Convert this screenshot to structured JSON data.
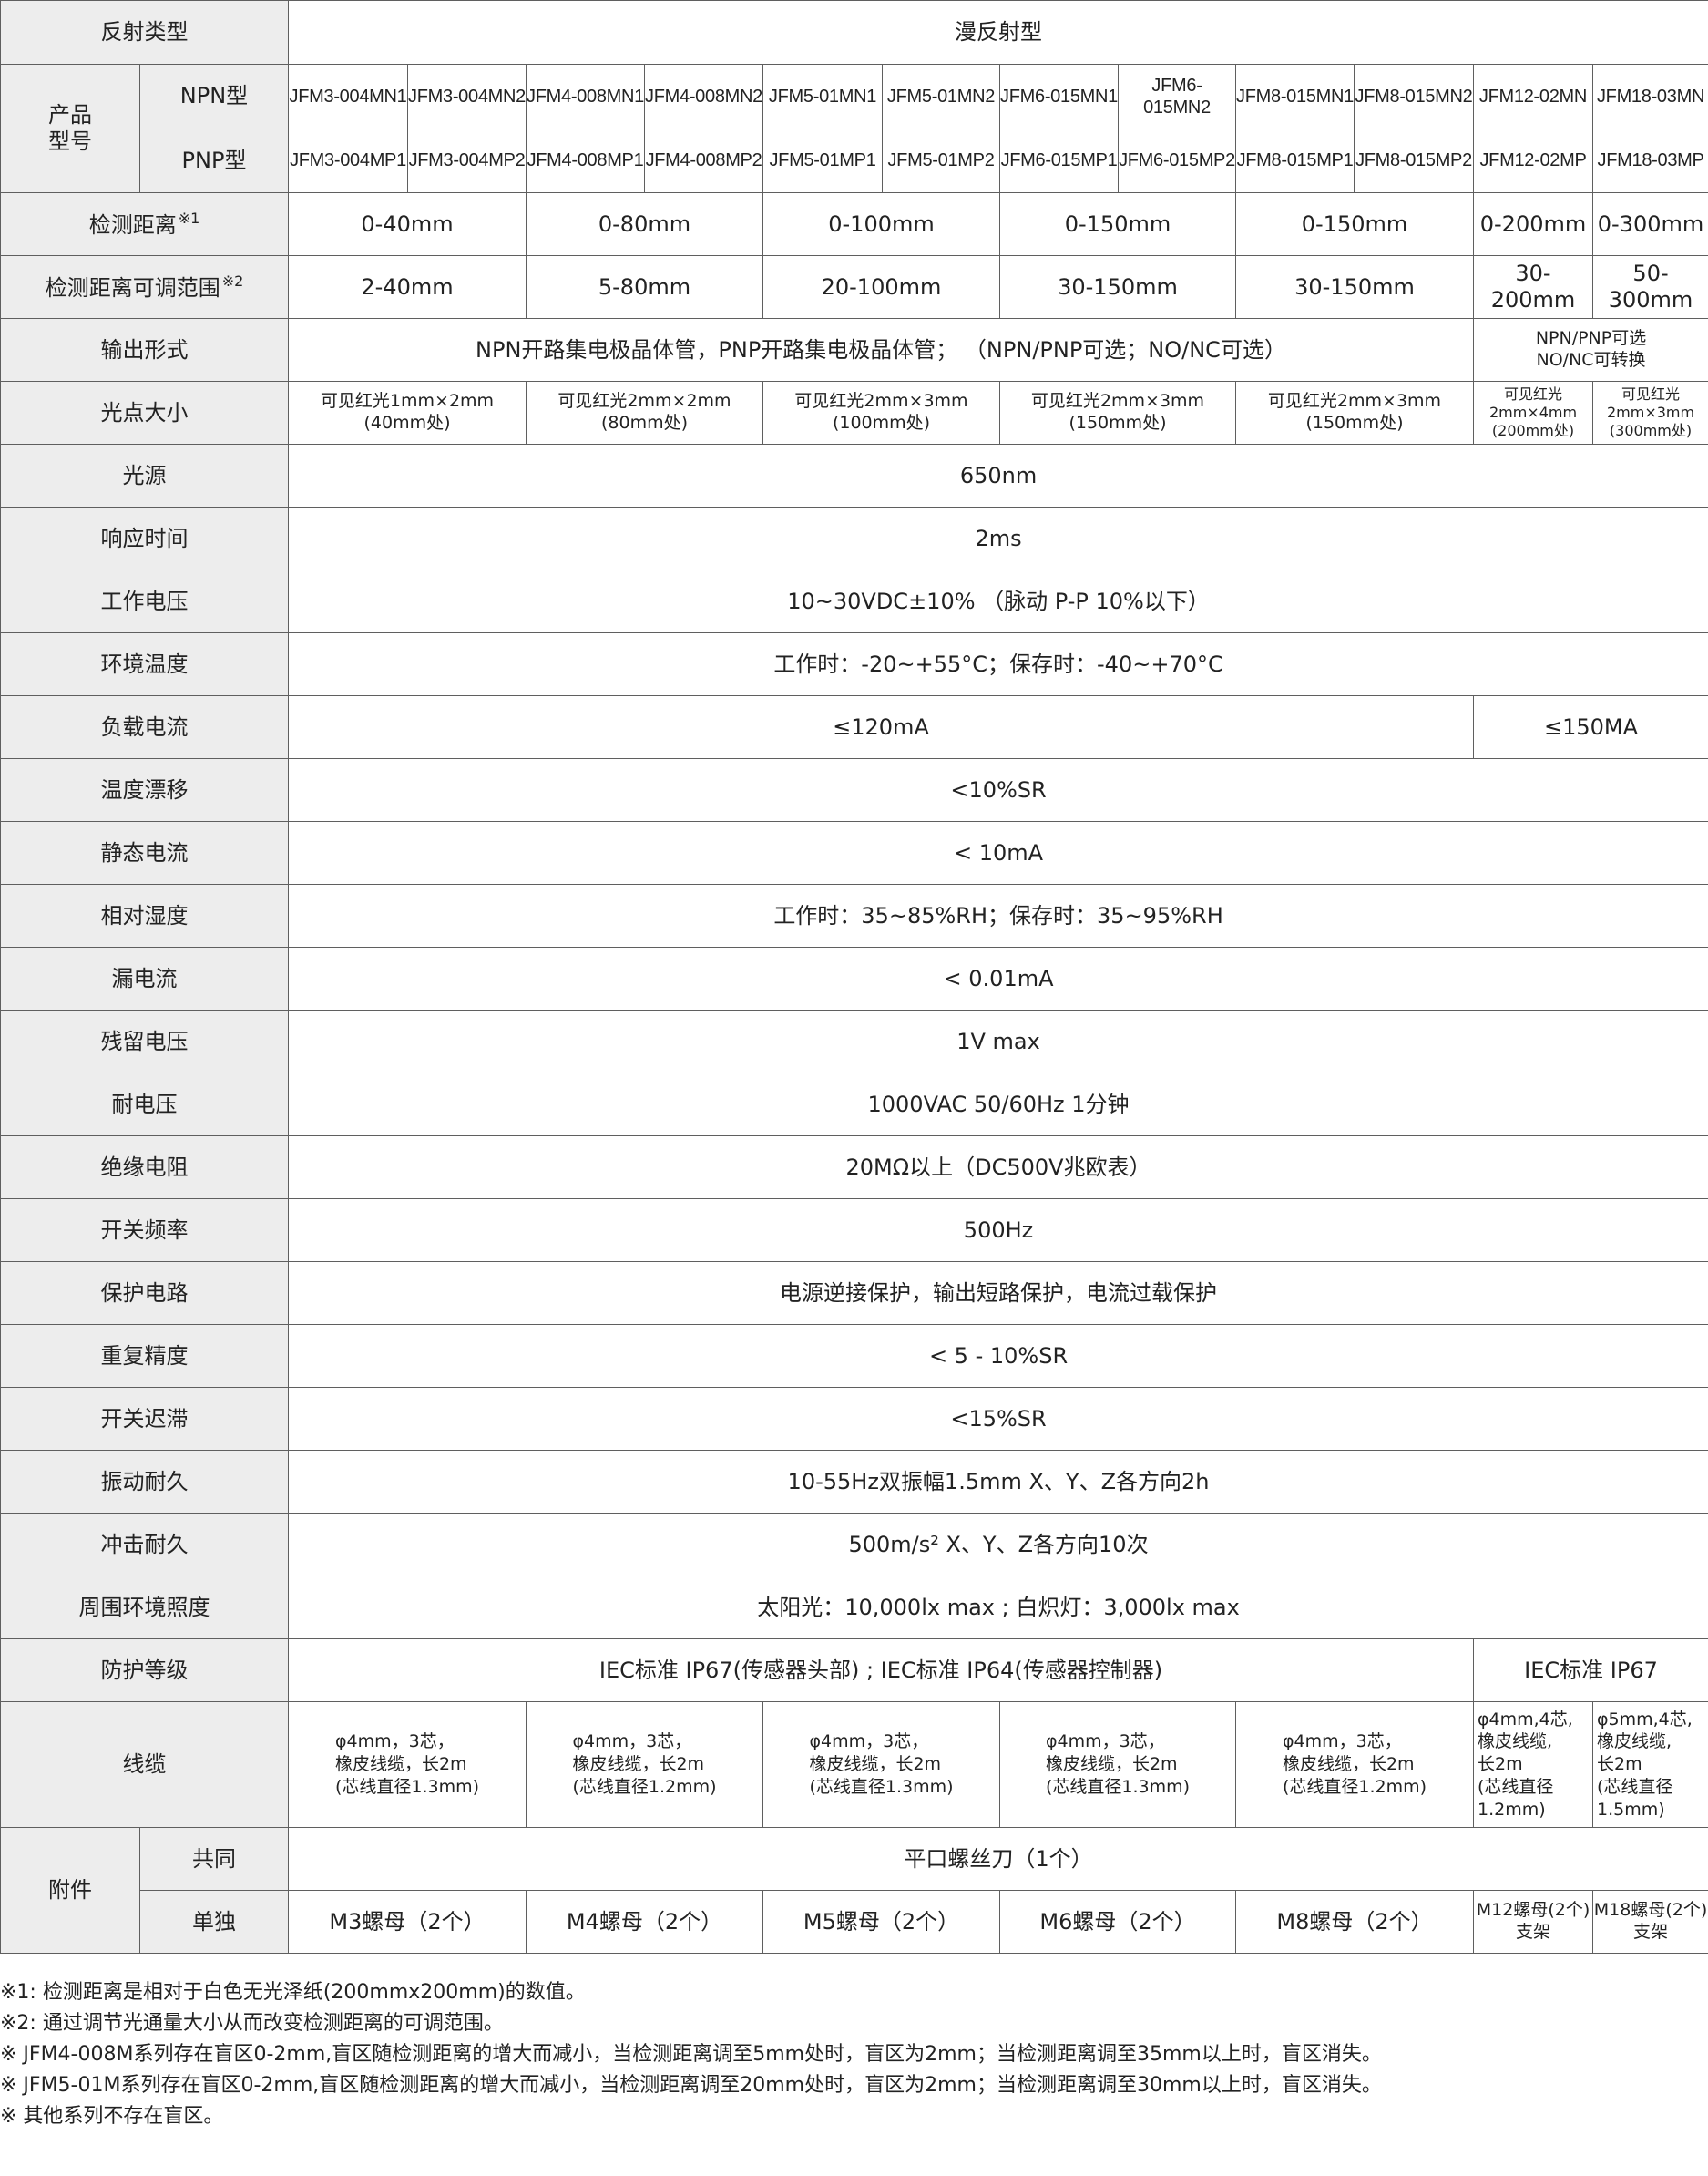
{
  "table": {
    "reflect_type": {
      "label": "反射类型",
      "value": "漫反射型"
    },
    "model": {
      "label": "产品\n型号",
      "npn_label": "NPN型",
      "pnp_label": "PNP型",
      "npn": [
        "JFM3-004MN1",
        "JFM3-004MN2",
        "JFM4-008MN1",
        "JFM4-008MN2",
        "JFM5-01MN1",
        "JFM5-01MN2",
        "JFM6-015MN1",
        "JFM6-015MN2",
        "JFM8-015MN1",
        "JFM8-015MN2",
        "JFM12-02MN",
        "JFM18-03MN"
      ],
      "pnp": [
        "JFM3-004MP1",
        "JFM3-004MP2",
        "JFM4-008MP1",
        "JFM4-008MP2",
        "JFM5-01MP1",
        "JFM5-01MP2",
        "JFM6-015MP1",
        "JFM6-015MP2",
        "JFM8-015MP1",
        "JFM8-015MP2",
        "JFM12-02MP",
        "JFM18-03MP"
      ]
    },
    "detect_distance": {
      "label": "检测距离",
      "note": "※1",
      "values": [
        "0-40mm",
        "0-80mm",
        "0-100mm",
        "0-150mm",
        "0-150mm",
        "0-200mm",
        "0-300mm"
      ]
    },
    "adjust_range": {
      "label": "检测距离可调范围",
      "note": "※2",
      "values": [
        "2-40mm",
        "5-80mm",
        "20-100mm",
        "30-150mm",
        "30-150mm",
        "30-200mm",
        "50-300mm"
      ]
    },
    "output": {
      "label": "输出形式",
      "main": "NPN开路集电极晶体管，PNP开路集电极晶体管； （NPN/PNP可选；NO/NC可选）",
      "alt": "NPN/PNP可选\nNO/NC可转换"
    },
    "spot": {
      "label": "光点大小",
      "values": [
        "可见红光1mm×2mm\n(40mm处)",
        "可见红光2mm×2mm\n(80mm处)",
        "可见红光2mm×3mm\n(100mm处)",
        "可见红光2mm×3mm\n(150mm处)",
        "可见红光2mm×3mm\n(150mm处)",
        "可见红光\n2mm×4mm\n(200mm处)",
        "可见红光\n2mm×3mm\n(300mm处)"
      ]
    },
    "light_source": {
      "label": "光源",
      "value": "650nm"
    },
    "response": {
      "label": "响应时间",
      "value": "2ms"
    },
    "voltage": {
      "label": "工作电压",
      "value": "10~30VDC±10% （脉动 P-P 10%以下）"
    },
    "ambient_temp": {
      "label": "环境温度",
      "value": "工作时：-20~+55°C；保存时：-40~+70°C"
    },
    "load_current": {
      "label": "负载电流",
      "main": "≤120mA",
      "alt": "≤150MA"
    },
    "temp_drift": {
      "label": "温度漂移",
      "value": "<10%SR"
    },
    "static_current": {
      "label": "静态电流",
      "value": "< 10mA"
    },
    "humidity": {
      "label": "相对湿度",
      "value": "工作时：35~85%RH；保存时：35~95%RH"
    },
    "leak_current": {
      "label": "漏电流",
      "value": "< 0.01mA"
    },
    "residual_voltage": {
      "label": "残留电压",
      "value": "1V max"
    },
    "withstand_voltage": {
      "label": "耐电压",
      "value": "1000VAC 50/60Hz 1分钟"
    },
    "insulation": {
      "label": "绝缘电阻",
      "value": "20MΩ以上（DC500V兆欧表）"
    },
    "switch_freq": {
      "label": "开关频率",
      "value": "500Hz"
    },
    "protection_circuit": {
      "label": "保护电路",
      "value": "电源逆接保护，输出短路保护，电流过载保护"
    },
    "repeat_accuracy": {
      "label": "重复精度",
      "value": "< 5 - 10%SR"
    },
    "hysteresis": {
      "label": "开关迟滞",
      "value": "<15%SR"
    },
    "vibration": {
      "label": "振动耐久",
      "value": "10-55Hz双振幅1.5mm X、Y、Z各方向2h"
    },
    "shock": {
      "label": "冲击耐久",
      "value": "500m/s² X、Y、Z各方向10次"
    },
    "illuminance": {
      "label": "周围环境照度",
      "value": "太阳光：10,000lx max ; 白炽灯：3,000lx max"
    },
    "ip_rating": {
      "label": "防护等级",
      "main": "IEC标准 IP67(传感器头部) ; IEC标准 IP64(传感器控制器)",
      "alt": "IEC标准 IP67"
    },
    "cable": {
      "label": "线缆",
      "values": [
        "φ4mm，3芯，\n橡皮线缆，长2m\n(芯线直径1.3mm)",
        "φ4mm，3芯，\n橡皮线缆，长2m\n(芯线直径1.2mm)",
        "φ4mm，3芯，\n橡皮线缆，长2m\n(芯线直径1.3mm)",
        "φ4mm，3芯，\n橡皮线缆，长2m\n(芯线直径1.3mm)",
        "φ4mm，3芯，\n橡皮线缆，长2m\n(芯线直径1.2mm)",
        "φ4mm,4芯,\n橡皮线缆,\n长2m\n(芯线直径\n1.2mm)",
        "φ5mm,4芯,\n橡皮线缆,\n长2m\n(芯线直径\n1.5mm)"
      ]
    },
    "accessory": {
      "label": "附件",
      "common_label": "共同",
      "common_value": "平口螺丝刀（1个）",
      "single_label": "单独",
      "single_values": [
        "M3螺母（2个）",
        "M4螺母（2个）",
        "M5螺母（2个）",
        "M6螺母（2个）",
        "M8螺母（2个）",
        "M12螺母(2个)\n支架",
        "M18螺母(2个)\n支架"
      ]
    }
  },
  "notes": [
    "※1: 检测距离是相对于白色无光泽纸(200mmx200mm)的数值。",
    "※2: 通过调节光通量大小从而改变检测距离的可调范围。",
    "※ JFM4-008M系列存在盲区0-2mm,盲区随检测距离的增大而减小，当检测距离调至5mm处时，盲区为2mm；当检测距离调至35mm以上时，盲区消失。",
    "※ JFM5-01M系列存在盲区0-2mm,盲区随检测距离的增大而减小，当检测距离调至20mm处时，盲区为2mm；当检测距离调至30mm以上时，盲区消失。",
    "※ 其他系列不存在盲区。"
  ]
}
